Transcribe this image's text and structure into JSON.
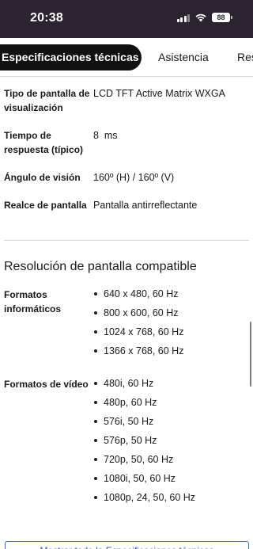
{
  "status_bar": {
    "time": "20:38",
    "battery": "88"
  },
  "tabs": {
    "active": "Especificaciones técnicas",
    "assistance": "Asistencia",
    "more": "Res"
  },
  "specs": [
    {
      "label": "Tipo de pantalla de visualización",
      "value": "LCD TFT Active Matrix WXGA"
    },
    {
      "label": "Tiempo de respuesta (típico)",
      "value": "8  ms"
    },
    {
      "label": "Ángulo de visión",
      "value": "160º (H) / 160º (V)"
    },
    {
      "label": "Realce de pantalla",
      "value": "Pantalla antirreflectante"
    }
  ],
  "resolution_section": {
    "title": "Resolución de pantalla compatible",
    "computer_formats": {
      "label": "Formatos informáticos",
      "items": [
        "640 x 480, 60 Hz",
        "800 x 600, 60 Hz",
        "1024 x 768, 60 Hz",
        "1366 x 768, 60 Hz"
      ]
    },
    "video_formats": {
      "label": "Formatos de vídeo",
      "items": [
        "480i, 60 Hz",
        "480p, 60 Hz",
        "576i, 50 Hz",
        "576p, 50 Hz",
        "720p, 50, 60 Hz",
        "1080i, 50, 60 Hz",
        "1080p, 24, 50, 60 Hz"
      ]
    }
  },
  "footer": {
    "show_all_label": "Mostrar todo la Especificaciones técnicas"
  },
  "colors": {
    "status_bar_bg": "#2b2430",
    "active_tab_bg": "#111111",
    "link_blue": "#2d5aa0"
  },
  "icons": [
    "signal-icon",
    "wifi-icon",
    "battery-icon"
  ]
}
